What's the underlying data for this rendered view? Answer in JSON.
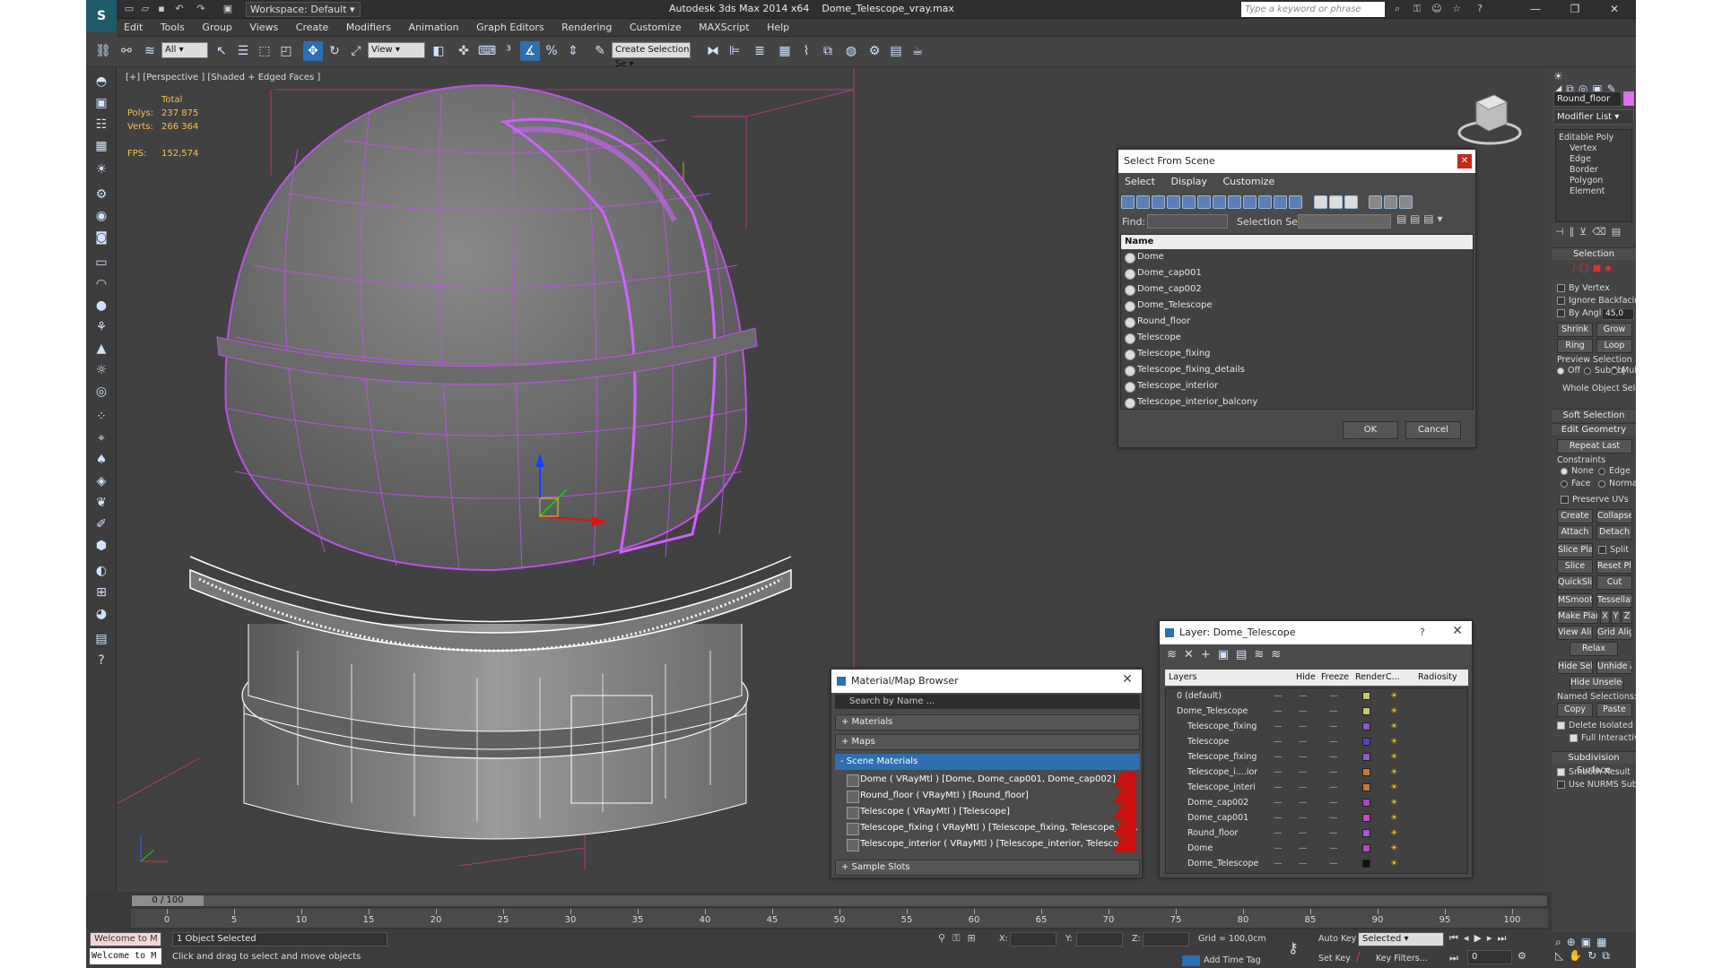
{
  "app": {
    "title": "Autodesk 3ds Max  2014 x64",
    "file": "Dome_Telescope_vray.max",
    "workspace": "Workspace: Default",
    "search_placeholder": "Type a keyword or phrase"
  },
  "menu": [
    "Edit",
    "Tools",
    "Group",
    "Views",
    "Create",
    "Modifiers",
    "Animation",
    "Graph Editors",
    "Rendering",
    "Customize",
    "MAXScript",
    "Help"
  ],
  "toolbar": {
    "filter": "All",
    "refcoord": "View",
    "selection_set": "Create Selection Se"
  },
  "viewport": {
    "label": "[+] [Perspective ] [Shaded + Edged Faces ]",
    "stats_total": "Total",
    "polys_label": "Polys:",
    "polys": "237 875",
    "verts_label": "Verts:",
    "verts": "266 364",
    "fps_label": "FPS:",
    "fps": "152,574"
  },
  "select_scene": {
    "title": "Select From Scene",
    "menu": [
      "Select",
      "Display",
      "Customize"
    ],
    "find_label": "Find:",
    "selset_label": "Selection Set:",
    "col_name": "Name",
    "items": [
      "Dome",
      "Dome_cap001",
      "Dome_cap002",
      "Dome_Telescope",
      "Round_floor",
      "Telescope",
      "Telescope_fixing",
      "Telescope_fixing_details",
      "Telescope_interior",
      "Telescope_interior_balcony"
    ],
    "ok": "OK",
    "cancel": "Cancel"
  },
  "layer": {
    "title": "Layer: Dome_Telescope",
    "help": "?",
    "cols": [
      "Layers",
      "Hide",
      "Freeze",
      "Render",
      "C...",
      "Radiosity"
    ],
    "rows": [
      {
        "name": "0 (default)",
        "color": "#c8c864",
        "indent": 0
      },
      {
        "name": "Dome_Telescope",
        "color": "#c8c864",
        "indent": 0
      },
      {
        "name": "Telescope_fixing",
        "color": "#8855cc",
        "indent": 1
      },
      {
        "name": "Telescope",
        "color": "#5544cc",
        "indent": 1
      },
      {
        "name": "Telescope_fixing",
        "color": "#9955cc",
        "indent": 1
      },
      {
        "name": "Telescope_i....ior",
        "color": "#cc7733",
        "indent": 1
      },
      {
        "name": "Telescope_interi",
        "color": "#cc7733",
        "indent": 1
      },
      {
        "name": "Dome_cap002",
        "color": "#aa44cc",
        "indent": 1
      },
      {
        "name": "Dome_cap001",
        "color": "#cc44cc",
        "indent": 1
      },
      {
        "name": "Round_floor",
        "color": "#aa55dd",
        "indent": 1
      },
      {
        "name": "Dome",
        "color": "#bb44cc",
        "indent": 1
      },
      {
        "name": "Dome_Telescope",
        "color": "#111111",
        "indent": 1
      }
    ]
  },
  "matbrowser": {
    "title": "Material/Map Browser",
    "search": "Search by Name ...",
    "materials": "+ Materials",
    "maps": "+ Maps",
    "scene_materials": "- Scene Materials",
    "items": [
      "Dome  ( VRayMtl )  [Dome, Dome_cap001, Dome_cap002]",
      "Round_floor  ( VRayMtl )  [Round_floor]",
      "Telescope  ( VRayMtl )  [Telescope]",
      "Telescope_fixing  ( VRayMtl )  [Telescope_fixing, Telescope_fixi...",
      "Telescope_interior  ( VRayMtl )  [Telescope_interior, Telescope_..."
    ],
    "sample_slots": "+ Sample Slots"
  },
  "cmd": {
    "object_name": "Round_floor",
    "modifier_list": "Modifier List",
    "stack": [
      "Editable Poly",
      "Vertex",
      "Edge",
      "Border",
      "Polygon",
      "Element"
    ],
    "selection": "Selection",
    "by_vertex": "By Vertex",
    "ignore_backfacing": "Ignore Backfacing",
    "by_angle": "By Angle:",
    "angle_value": "45,0",
    "shrink": "Shrink",
    "grow": "Grow",
    "ring": "Ring",
    "loop": "Loop",
    "preview_selection": "Preview Selection",
    "off": "Off",
    "subobj": "SubObj",
    "multi": "Multi",
    "whole_selected": "Whole Object Selected",
    "soft_selection": "Soft Selection",
    "edit_geometry": "Edit Geometry",
    "repeat_last": "Repeat Last",
    "constraints": "Constraints",
    "none": "None",
    "edge": "Edge",
    "face": "Face",
    "normal": "Normal",
    "preserve_uvs": "Preserve UVs",
    "create": "Create",
    "collapse": "Collapse",
    "attach": "Attach",
    "detach": "Detach",
    "slice_plane": "Slice Plane",
    "split": "Split",
    "slice": "Slice",
    "reset_plane": "Reset Plane",
    "quickslice": "QuickSlice",
    "cut": "Cut",
    "msmooth": "MSmooth",
    "tessellate": "Tessellate",
    "make_planar": "Make Planar",
    "x": "X",
    "y": "Y",
    "z": "Z",
    "view_align": "View Align",
    "grid_align": "Grid Align",
    "relax": "Relax",
    "hide_selected": "Hide Selected",
    "unhide_all": "Unhide All",
    "hide_unselected": "Hide Unselected",
    "named_selections": "Named Selections:",
    "copy": "Copy",
    "paste": "Paste",
    "delete_isolated": "Delete Isolated Vertices",
    "full_interactivity": "Full Interactivity",
    "subdivision_surface": "Subdivision Surface",
    "smooth_result": "Smooth Result",
    "use_nurms": "Use NURMS Subdivision"
  },
  "timeline": {
    "frame": "0 / 100",
    "ticks": [
      "0",
      "5",
      "10",
      "15",
      "20",
      "25",
      "30",
      "35",
      "40",
      "45",
      "50",
      "55",
      "60",
      "65",
      "70",
      "75",
      "80",
      "85",
      "90",
      "95",
      "100"
    ]
  },
  "status": {
    "maxscript": "Welcome to M",
    "selected": "1 Object Selected",
    "prompt": "Click and drag to select and move objects",
    "x_label": "X:",
    "y_label": "Y:",
    "z_label": "Z:",
    "grid": "Grid = 100,0cm",
    "auto_key": "Auto Key",
    "selected_dd": "Selected",
    "set_key": "Set Key",
    "key_filters": "Key Filters...",
    "add_time_tag": "Add Time Tag",
    "frame_field": "0"
  },
  "colors": {
    "wire": "#c050e8",
    "accent": "#2d6fb0"
  }
}
